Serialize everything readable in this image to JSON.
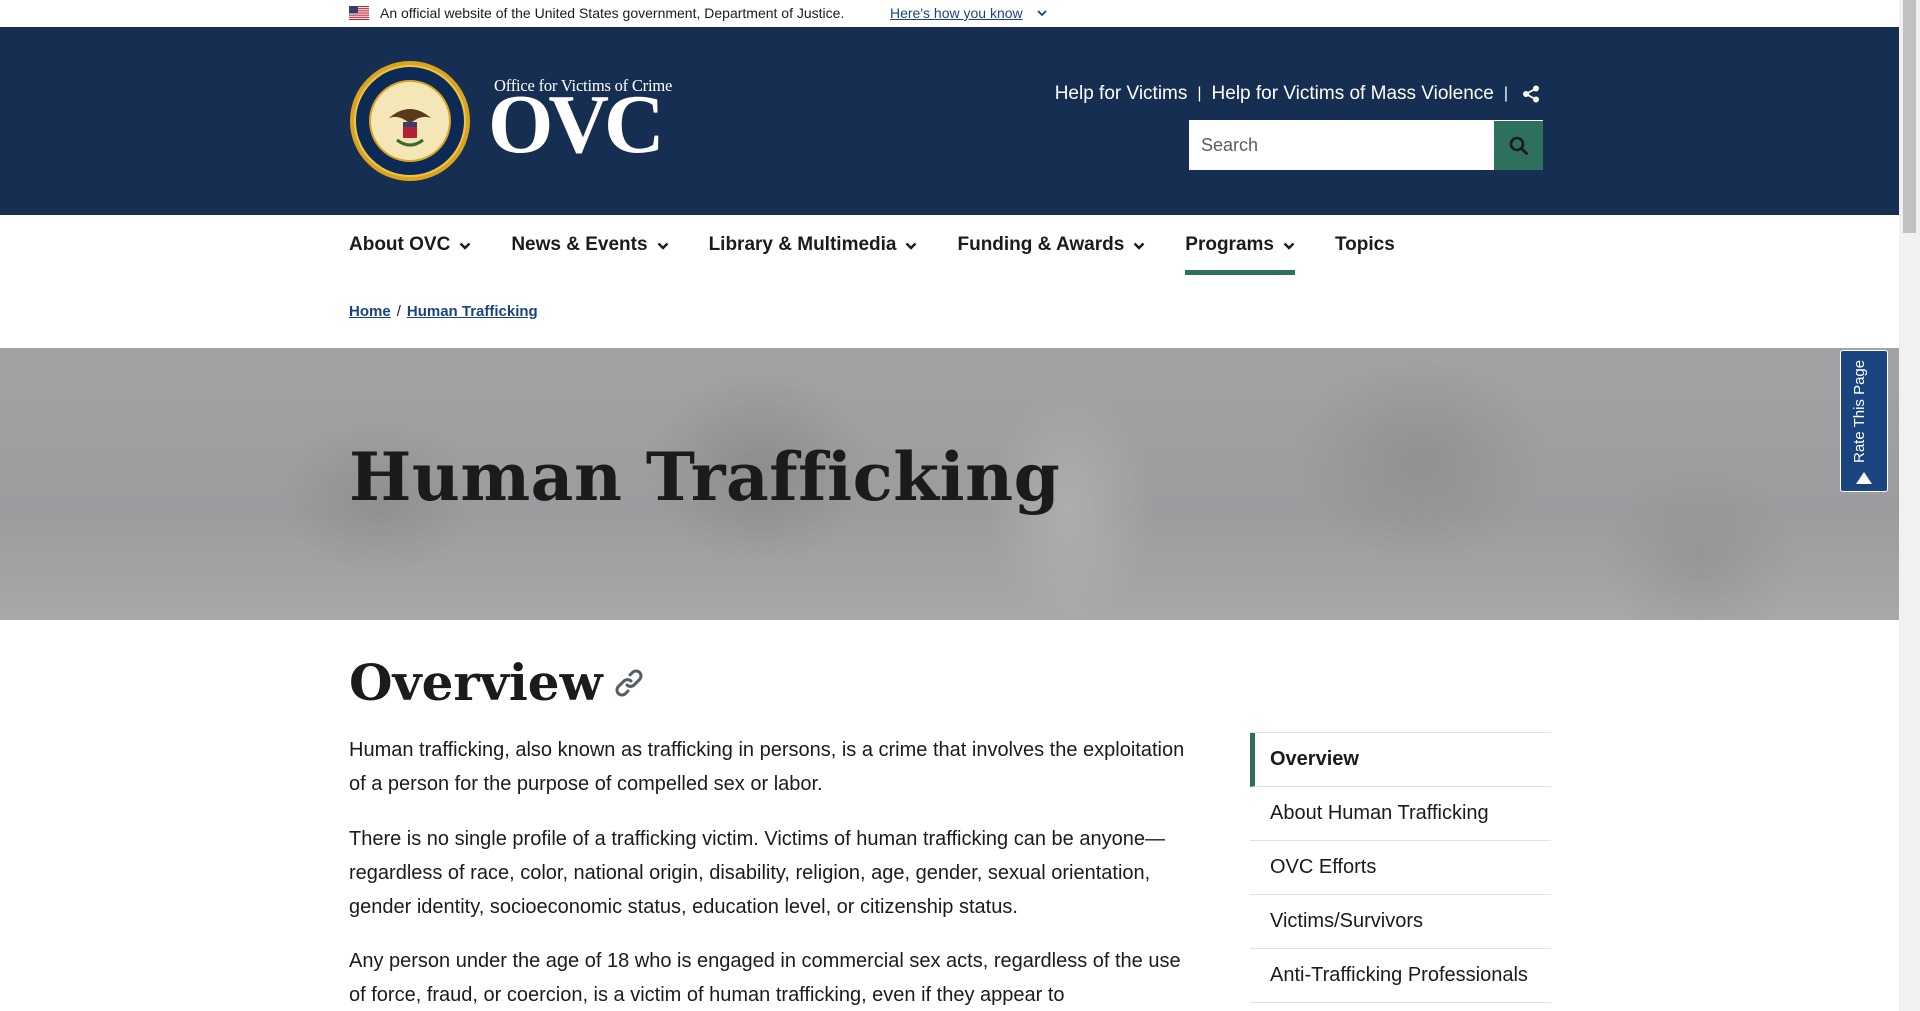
{
  "gov_banner": {
    "text": "An official website of the United States government, Department of Justice.",
    "link": "Here's how you know"
  },
  "header": {
    "logo_small": "Office for Victims of Crime",
    "logo_big": "OVC",
    "links": [
      "Help for Victims",
      "Help for Victims of Mass Violence"
    ],
    "separator": "|",
    "search_placeholder": "Search"
  },
  "nav": {
    "items": [
      {
        "label": "About OVC",
        "has_dropdown": true
      },
      {
        "label": "News & Events",
        "has_dropdown": true
      },
      {
        "label": "Library & Multimedia",
        "has_dropdown": true
      },
      {
        "label": "Funding & Awards",
        "has_dropdown": true
      },
      {
        "label": "Programs",
        "has_dropdown": true,
        "active": true
      },
      {
        "label": "Topics",
        "has_dropdown": false
      }
    ]
  },
  "breadcrumb": {
    "items": [
      "Home",
      "Human Trafficking"
    ],
    "separator": "/"
  },
  "hero": {
    "title": "Human Trafficking"
  },
  "overview": {
    "title": "Overview",
    "paragraphs": [
      "Human trafficking, also known as trafficking in persons, is a crime that involves the exploitation of a person for the purpose of compelled sex or labor.",
      "There is no single profile of a trafficking victim. Victims of human trafficking can be anyone—regardless of race, color, national origin, disability, religion, age, gender, sexual orientation, gender identity, socioeconomic status, education level, or citizenship status.",
      "Any person under the age of 18 who is engaged in commercial sex acts, regardless of the use of force, fraud, or coercion, is a victim of human trafficking, even if they appear to"
    ]
  },
  "sidenav": {
    "items": [
      {
        "label": "Overview",
        "active": true
      },
      {
        "label": "About Human Trafficking"
      },
      {
        "label": "OVC Efforts"
      },
      {
        "label": "Victims/Survivors"
      },
      {
        "label": "Anti-Trafficking Professionals"
      }
    ]
  },
  "rate_button": "Rate This Page",
  "colors": {
    "header_bg": "#162e51",
    "accent_green": "#2e6f5d",
    "link_blue": "#1a4480",
    "rate_bg": "#1a4480"
  },
  "icons": {
    "flag": "us-flag-icon",
    "share": "share-icon",
    "search": "search-icon",
    "link": "link-icon",
    "seal": "doj-seal-icon"
  }
}
